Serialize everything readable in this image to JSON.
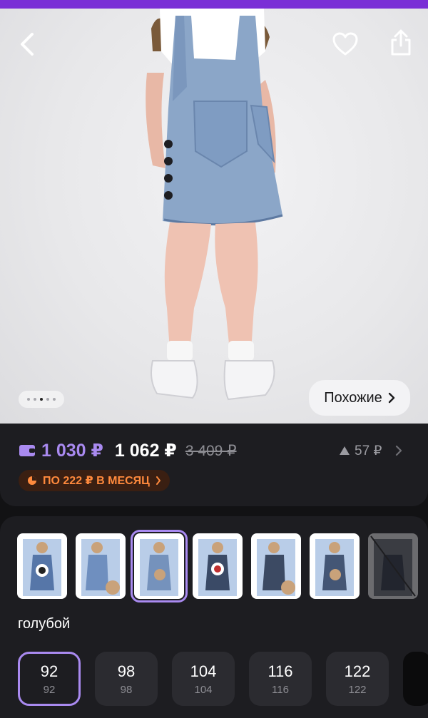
{
  "header": {
    "back_icon": "chevron-left-icon",
    "favorite_icon": "heart-icon",
    "share_icon": "share-icon"
  },
  "gallery": {
    "image_count": 5,
    "active_index": 2,
    "similar_label": "Похожие"
  },
  "prices": {
    "wallet_price": "1 030 ₽",
    "price": "1 062 ₽",
    "old_price": "3 409 ₽",
    "points": "57 ₽",
    "installment": "ПО 222 ₽ В МЕСЯЦ"
  },
  "colors": {
    "accent": "#a98af0",
    "brand_bar": "#7a2fd6",
    "installment": "#ff8a3d",
    "selected_label": "голубой",
    "thumbs": [
      {
        "name": "thumb-1"
      },
      {
        "name": "thumb-2"
      },
      {
        "name": "thumb-3",
        "selected": true
      },
      {
        "name": "thumb-4"
      },
      {
        "name": "thumb-5"
      },
      {
        "name": "thumb-6"
      },
      {
        "name": "thumb-7",
        "dimmed": true
      }
    ]
  },
  "sizes": [
    {
      "label": "92",
      "sub": "92",
      "selected": true
    },
    {
      "label": "98",
      "sub": "98"
    },
    {
      "label": "104",
      "sub": "104"
    },
    {
      "label": "116",
      "sub": "116"
    },
    {
      "label": "122",
      "sub": "122"
    }
  ]
}
